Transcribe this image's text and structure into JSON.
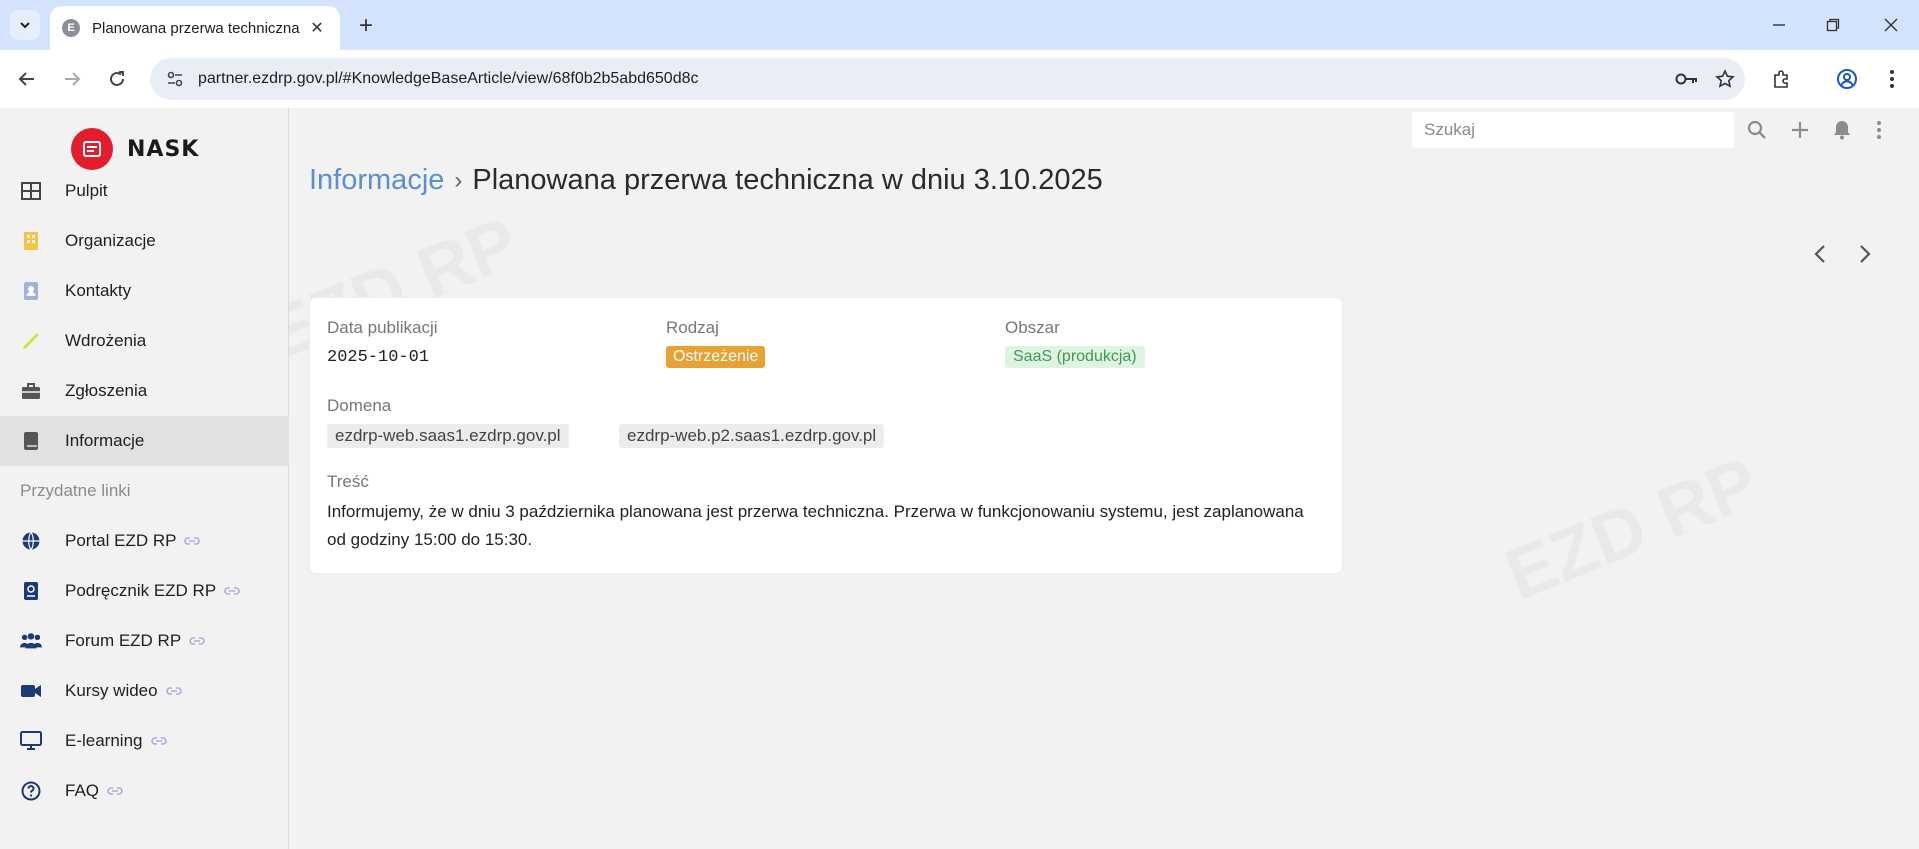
{
  "browser": {
    "tab_title": "Planowana przerwa techniczna w dniu 3.10.2025",
    "url": "partner.ezdrp.gov.pl/#KnowledgeBaseArticle/view/68f0b2b5abd650d8c",
    "favicon_letter": "E"
  },
  "sidebar": {
    "logo_text": "NASK",
    "items": [
      {
        "label": "Pulpit",
        "icon": "dashboard-icon"
      },
      {
        "label": "Organizacje",
        "icon": "building-icon"
      },
      {
        "label": "Kontakty",
        "icon": "contact-card-icon"
      },
      {
        "label": "Wdrożenia",
        "icon": "pencil-icon"
      },
      {
        "label": "Zgłoszenia",
        "icon": "briefcase-icon"
      },
      {
        "label": "Informacje",
        "icon": "book-icon",
        "active": true
      }
    ],
    "section_label": "Przydatne linki",
    "links": [
      {
        "label": "Portal EZD RP",
        "icon": "globe-icon"
      },
      {
        "label": "Podręcznik EZD RP",
        "icon": "manual-icon"
      },
      {
        "label": "Forum EZD RP",
        "icon": "people-icon"
      },
      {
        "label": "Kursy wideo",
        "icon": "video-icon"
      },
      {
        "label": "E-learning",
        "icon": "monitor-icon"
      },
      {
        "label": "FAQ",
        "icon": "question-icon"
      }
    ]
  },
  "header": {
    "search_placeholder": "Szukaj"
  },
  "breadcrumb": {
    "parent": "Informacje",
    "current": "Planowana przerwa techniczna w dniu 3.10.2025"
  },
  "article": {
    "date_label": "Data publikacji",
    "date_value": "2025-10-01",
    "type_label": "Rodzaj",
    "type_value": "Ostrzeżenie",
    "area_label": "Obszar",
    "area_value": "SaaS (produkcja)",
    "domain_label": "Domena",
    "domains": [
      "ezdrp-web.saas1.ezdrp.gov.pl",
      "ezdrp-web.p2.saas1.ezdrp.gov.pl"
    ],
    "content_label": "Treść",
    "content_text": "Informujemy, że w dniu 3 października planowana jest przerwa techniczna. Przerwa w funkcjonowaniu systemu, jest zaplanowana od godziny 15:00 do 15:30."
  },
  "colors": {
    "accent_link": "#5a8fd0",
    "warning_badge": "#e8a133",
    "success_badge_bg": "#dff3e3",
    "success_badge_text": "#3f9a54",
    "logo_red": "#e11d2e",
    "active_nav_bg": "#e1e1e4"
  }
}
